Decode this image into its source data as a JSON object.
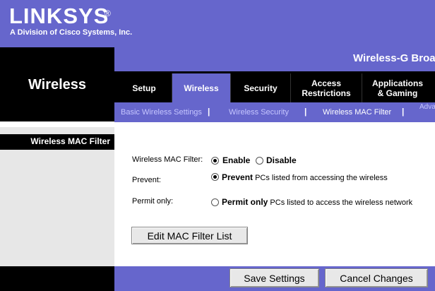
{
  "brand": {
    "name": "LINKSYS",
    "registered": "®",
    "tagline": "A Division of Cisco Systems, Inc."
  },
  "section_title": "Wireless",
  "product_name": "Wireless-G Broadb",
  "tabs": [
    {
      "label": "Setup",
      "active": false
    },
    {
      "label": "Wireless",
      "active": true
    },
    {
      "label": "Security",
      "active": false
    },
    {
      "label": "Access\nRestrictions",
      "active": false
    },
    {
      "label": "Applications\n& Gaming",
      "active": false
    }
  ],
  "subtabs": [
    {
      "label": "Basic Wireless Settings",
      "active": false
    },
    {
      "label": "Wireless Security",
      "active": false
    },
    {
      "label": "Wireless MAC Filter",
      "active": true
    }
  ],
  "subtab_separator": "|",
  "subtab_more": "Adva",
  "side_label": "Wireless MAC Filter",
  "form": {
    "mac_filter_label": "Wireless MAC Filter:",
    "enable_label": "Enable",
    "disable_label": "Disable",
    "mac_filter_value": "Enable",
    "prevent_label": "Prevent:",
    "prevent_bold": "Prevent",
    "prevent_rest": " PCs listed from accessing the wireless",
    "permit_label": "Permit only:",
    "permit_bold": "Permit only",
    "permit_rest": " PCs listed to access the wireless network",
    "mode_value": "Prevent",
    "edit_button": "Edit MAC Filter List"
  },
  "footer": {
    "save_button": "Save Settings",
    "cancel_button": "Cancel Changes"
  },
  "colors": {
    "brand_purple": "#6666cc",
    "black": "#000000",
    "panel_grey": "#e7e7e7"
  }
}
